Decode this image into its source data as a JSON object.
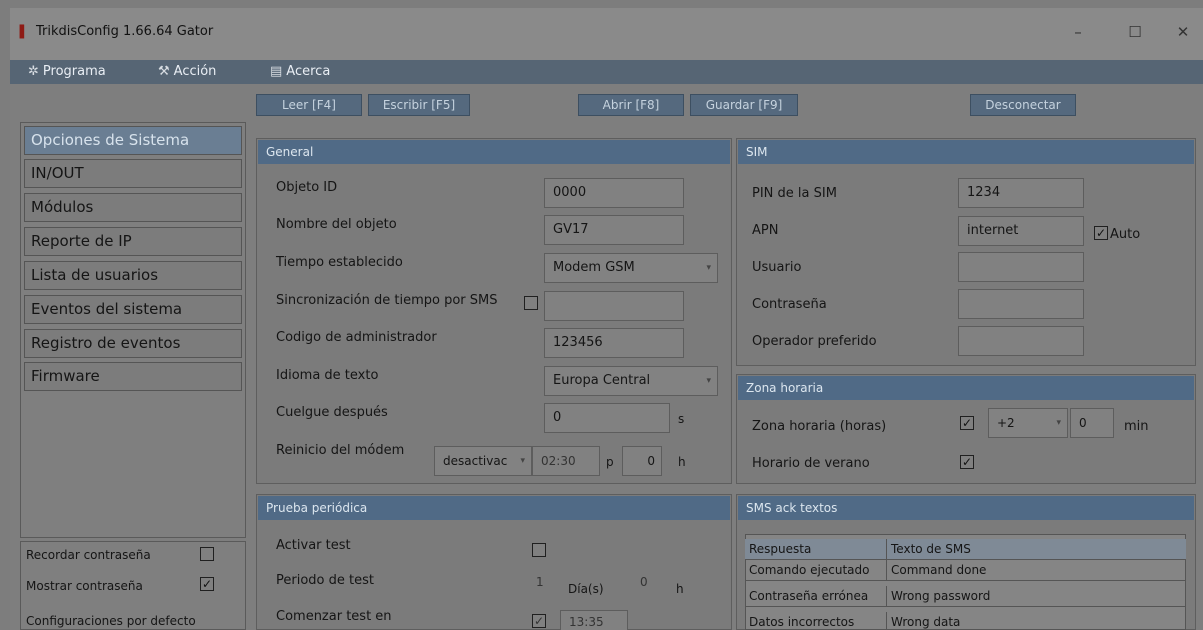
{
  "window": {
    "title": "TrikdisConfig 1.66.64   Gator",
    "minimize": "–",
    "maximize": "☐",
    "close": "✕"
  },
  "menu": {
    "programa": "Programa",
    "accion": "Acción",
    "acerca": "Acerca"
  },
  "toolbar": {
    "leer": "Leer [F4]",
    "escribir": "Escribir [F5]",
    "abrir": "Abrir [F8]",
    "guardar": "Guardar [F9]",
    "desconectar": "Desconectar"
  },
  "sidebar": {
    "items": [
      "Opciones de Sistema",
      "IN/OUT",
      "Módulos",
      "Reporte de IP",
      "Lista de usuarios",
      "Eventos del sistema",
      "Registro de eventos",
      "Firmware"
    ],
    "recordar": "Recordar contraseña",
    "mostrar": "Mostrar contraseña",
    "defecto": "Configuraciones por defecto"
  },
  "general": {
    "title": "General",
    "objeto_id_label": "Objeto ID",
    "objeto_id": "0000",
    "nombre_label": "Nombre del objeto",
    "nombre": "GV17",
    "tiempo_label": "Tiempo establecido",
    "tiempo": "Modem GSM",
    "sinc_label": "Sincronización de tiempo por SMS",
    "codigo_label": "Codigo de administrador",
    "codigo": "123456",
    "idioma_label": "Idioma de texto",
    "idioma": "Europa Central",
    "cuelgue_label": "Cuelgue después",
    "cuelgue": "0",
    "cuelgue_unit": "s",
    "reinicio_label": "Reinicio del módem",
    "reinicio": "desactivac",
    "reinicio_time": "02:30",
    "reinicio_p": "p",
    "reinicio_h_val": "0",
    "reinicio_h": "h"
  },
  "sim": {
    "title": "SIM",
    "pin_label": "PIN de la SIM",
    "pin": "1234",
    "apn_label": "APN",
    "apn": "internet",
    "auto": "Auto",
    "usuario_label": "Usuario",
    "pass_label": "Contraseña",
    "operador_label": "Operador preferido"
  },
  "zona": {
    "title": "Zona horaria",
    "zona_label": "Zona horaria (horas)",
    "zona_val": "+2",
    "min_val": "0",
    "min": "min",
    "verano_label": "Horario de verano"
  },
  "prueba": {
    "title": "Prueba periódica",
    "activar_label": "Activar test",
    "periodo_label": "Periodo de test",
    "periodo_val": "1",
    "dias": "Día(s)",
    "h_val": "0",
    "h": "h",
    "comenzar_label": "Comenzar test en",
    "comenzar_time": "13:35"
  },
  "sms": {
    "title": "SMS ack textos",
    "headers": [
      "Respuesta",
      "Texto de SMS"
    ],
    "rows": [
      [
        "Comando ejecutado",
        "Command done"
      ],
      [
        "Contraseña errónea",
        "Wrong password"
      ],
      [
        "Datos incorrectos",
        "Wrong data"
      ]
    ]
  }
}
